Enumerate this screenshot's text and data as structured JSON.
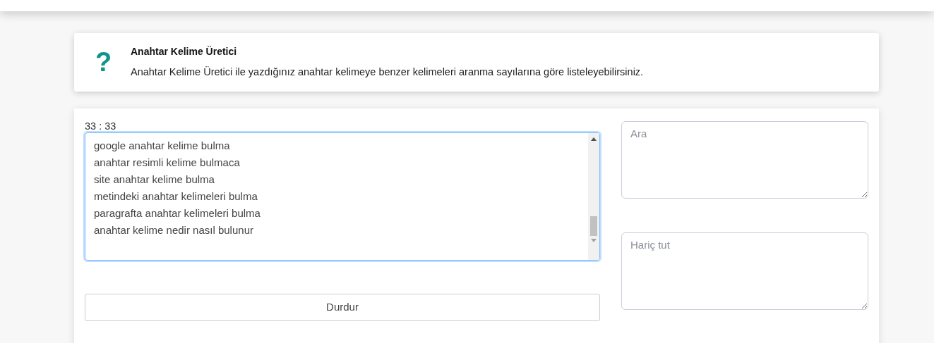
{
  "info": {
    "icon": "?",
    "title": "Anahtar Kelime Üretici",
    "description": "Anahtar Kelime Üretici ile yazdığınız anahtar kelimeye benzer kelimeleri aranma sayılarına göre listeleyebilirsiniz."
  },
  "counter": "33 : 33",
  "results": {
    "focused": true,
    "lines": [
      "google anahtar kelime bulma",
      "anahtar resimli kelime bulmaca",
      "site anahtar kelime bulma",
      "metindeki anahtar kelimeleri bulma",
      "paragrafta anahtar kelimeleri bulma",
      "anahtar kelime nedir nasıl bulunur"
    ]
  },
  "search": {
    "placeholder": "Ara"
  },
  "exclude": {
    "placeholder": "Hariç tut"
  },
  "stop_button": {
    "label": "Durdur"
  }
}
